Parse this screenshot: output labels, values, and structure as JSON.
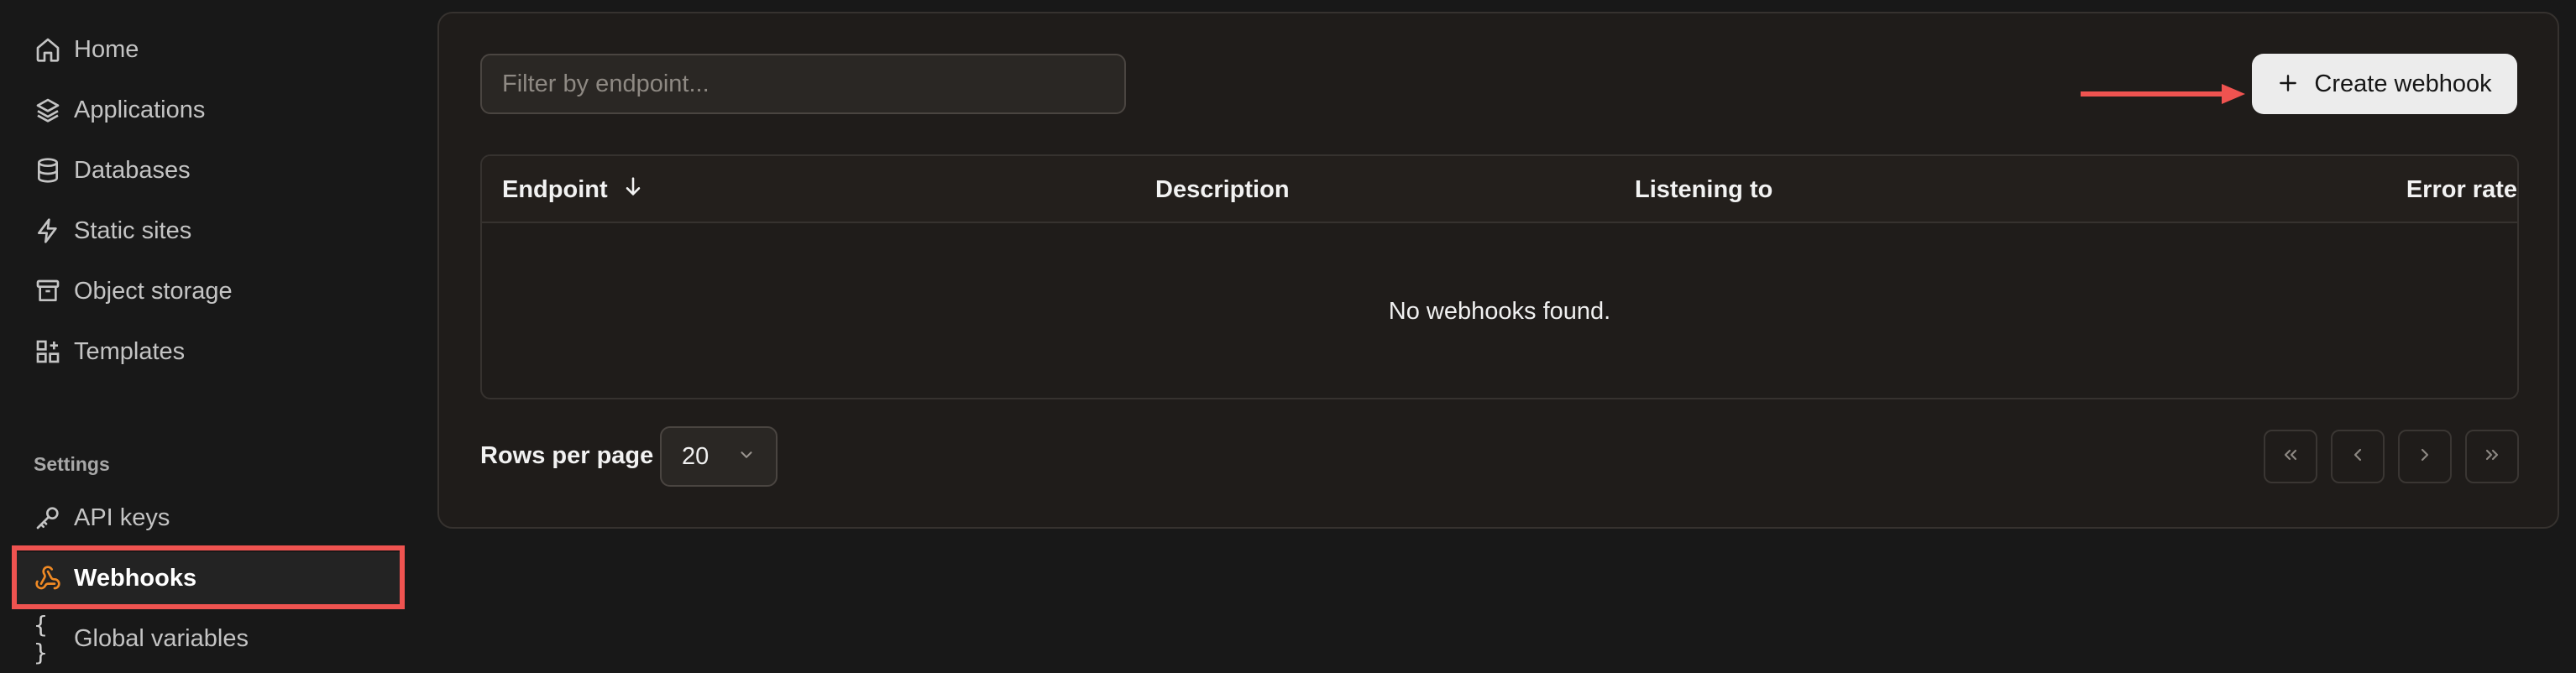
{
  "sidebar": {
    "items": [
      {
        "label": "Home",
        "icon": "home-icon"
      },
      {
        "label": "Applications",
        "icon": "layers-icon"
      },
      {
        "label": "Databases",
        "icon": "database-icon"
      },
      {
        "label": "Static sites",
        "icon": "lightning-icon"
      },
      {
        "label": "Object storage",
        "icon": "archive-icon"
      },
      {
        "label": "Templates",
        "icon": "grid-plus-icon"
      }
    ],
    "settings_label": "Settings",
    "settings_items": [
      {
        "label": "API keys",
        "icon": "key-icon"
      },
      {
        "label": "Webhooks",
        "icon": "webhook-icon",
        "active": true
      },
      {
        "label": "Global variables",
        "icon": "braces-icon",
        "glyph": "{ }"
      }
    ]
  },
  "main": {
    "filter_placeholder": "Filter by endpoint...",
    "create_button_label": "Create webhook",
    "table": {
      "columns": [
        "Endpoint",
        "Description",
        "Listening to",
        "Error rate"
      ],
      "empty_text": "No webhooks found."
    },
    "pagination": {
      "rows_per_page_label": "Rows per page",
      "rows_per_page_value": "20"
    }
  },
  "colors": {
    "accent_highlight": "#ef5350",
    "active_icon": "#f08a24",
    "background": "#181818",
    "panel": "#1f1c1a"
  }
}
